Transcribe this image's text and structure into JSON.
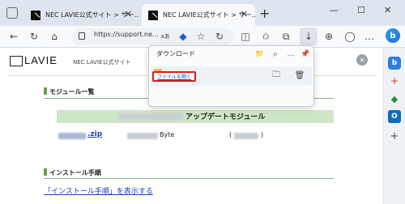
{
  "tabs": [
    {
      "title": "NEC LAVIE公式サイト > サー…",
      "close": "✕"
    },
    {
      "title": "NEC LAVIE公式サイト > サー…",
      "close": "✕"
    }
  ],
  "new_tab": "+",
  "window": {
    "minimize": "—",
    "maximize": "☐",
    "close": "✕"
  },
  "address": {
    "url": "https://support.ne..."
  },
  "toolbar_icons": {
    "back": "←",
    "refresh": "↻",
    "home": "⌂",
    "read_aloud": "aあ",
    "tag": "◆",
    "favorite": "☆",
    "refresh2": "↻",
    "split": "◫",
    "favorites": "✩",
    "collections": "⧉",
    "download": "↓",
    "extensions": "⊕",
    "profile": "◯",
    "menu": "…",
    "copilot": "b"
  },
  "page": {
    "logo": "LAVIE",
    "site_name": "NEC LAVIE公式サイト",
    "section1": "モジュール一覧",
    "module_heading": "アップデートモジュール",
    "zip_suffix": ".zip",
    "byte_label": "Byte",
    "paren_open": "(",
    "paren_close": ")",
    "section2": "インストール手順",
    "install_link": "「インストール手順」を表示する",
    "close_x": "✕"
  },
  "downloads": {
    "title": "ダウンロード",
    "open_file": "ファイルを開く",
    "folder_icon": "📁",
    "search_icon": "⌕",
    "more_icon": "…",
    "pin_icon": "📌",
    "show_folder": "🗀",
    "delete": "🗑"
  },
  "sidebar": {
    "icons": [
      "b",
      "+",
      "◆",
      "O",
      "+"
    ]
  }
}
